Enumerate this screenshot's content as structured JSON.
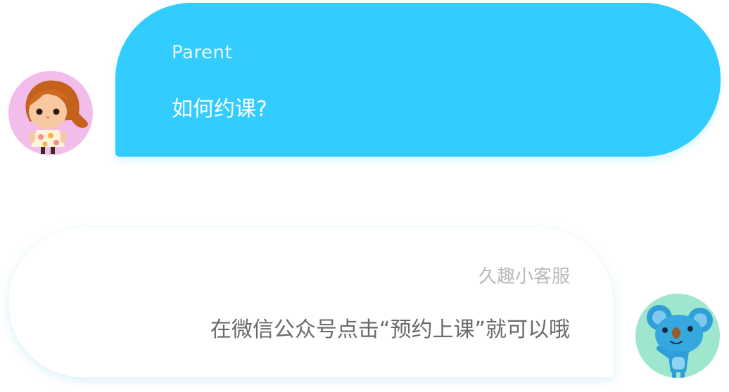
{
  "conversation": {
    "parent_message": {
      "sender": "Parent",
      "text": "如何约课?"
    },
    "service_message": {
      "sender": "久趣小客服",
      "text": "在微信公众号点击“预约上课”就可以哦"
    }
  },
  "avatars": {
    "parent": "girl-avatar-icon",
    "service": "koala-avatar-icon"
  },
  "colors": {
    "parent_bubble": "#33ccff",
    "service_bubble": "#ffffff",
    "parent_avatar_bg": "#f2bdea",
    "service_avatar_bg": "#9fe6cf"
  }
}
